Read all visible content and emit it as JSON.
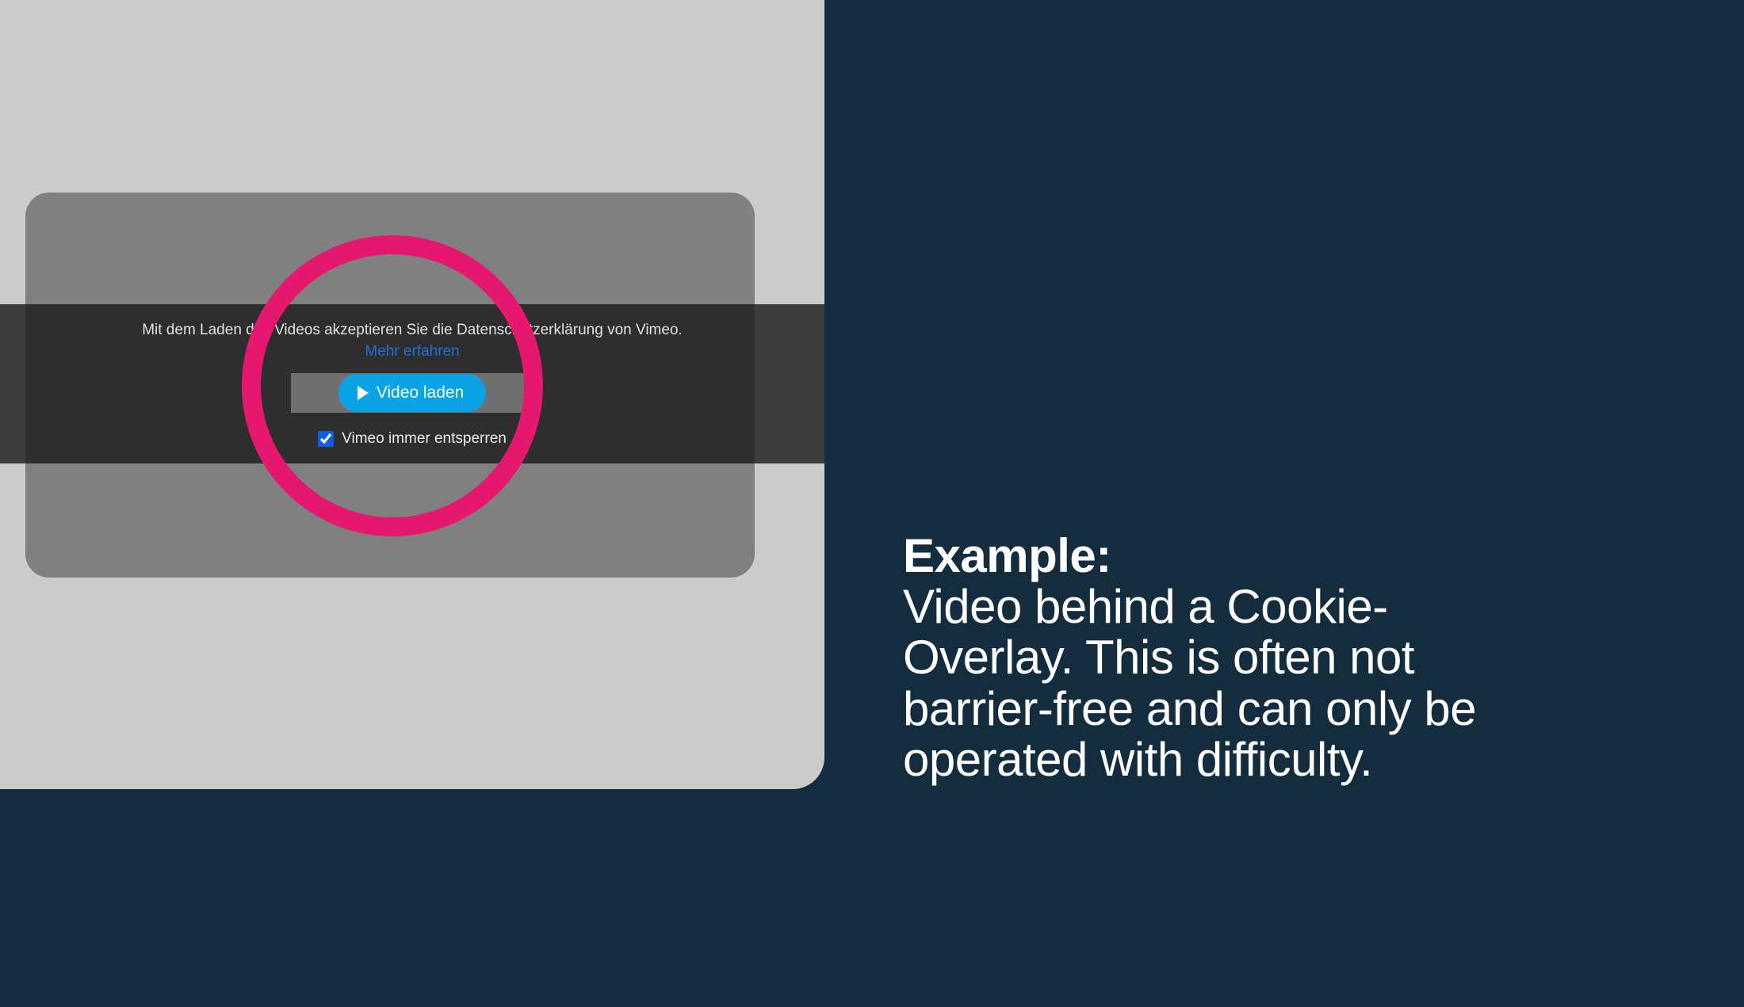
{
  "left": {
    "overlay": {
      "consent_text": "Mit dem Laden des Videos akzeptieren Sie die Datenschutzerklärung von Vimeo.",
      "learn_more": "Mehr erfahren",
      "load_button": "Video laden",
      "always_unlock": "Vimeo immer entsperren",
      "checkbox_checked": true
    }
  },
  "right": {
    "heading": "Example:",
    "body": "Video behind a Cookie-Overlay. This is often not barrier-free and can only be operated with difficulty."
  },
  "colors": {
    "slide_bg": "#132c3e",
    "panel_bg": "#cbcbcb",
    "video_bg": "#808080",
    "annotation": "#e5176e",
    "button": "#0aa4e6",
    "link": "#1e6fd9"
  }
}
